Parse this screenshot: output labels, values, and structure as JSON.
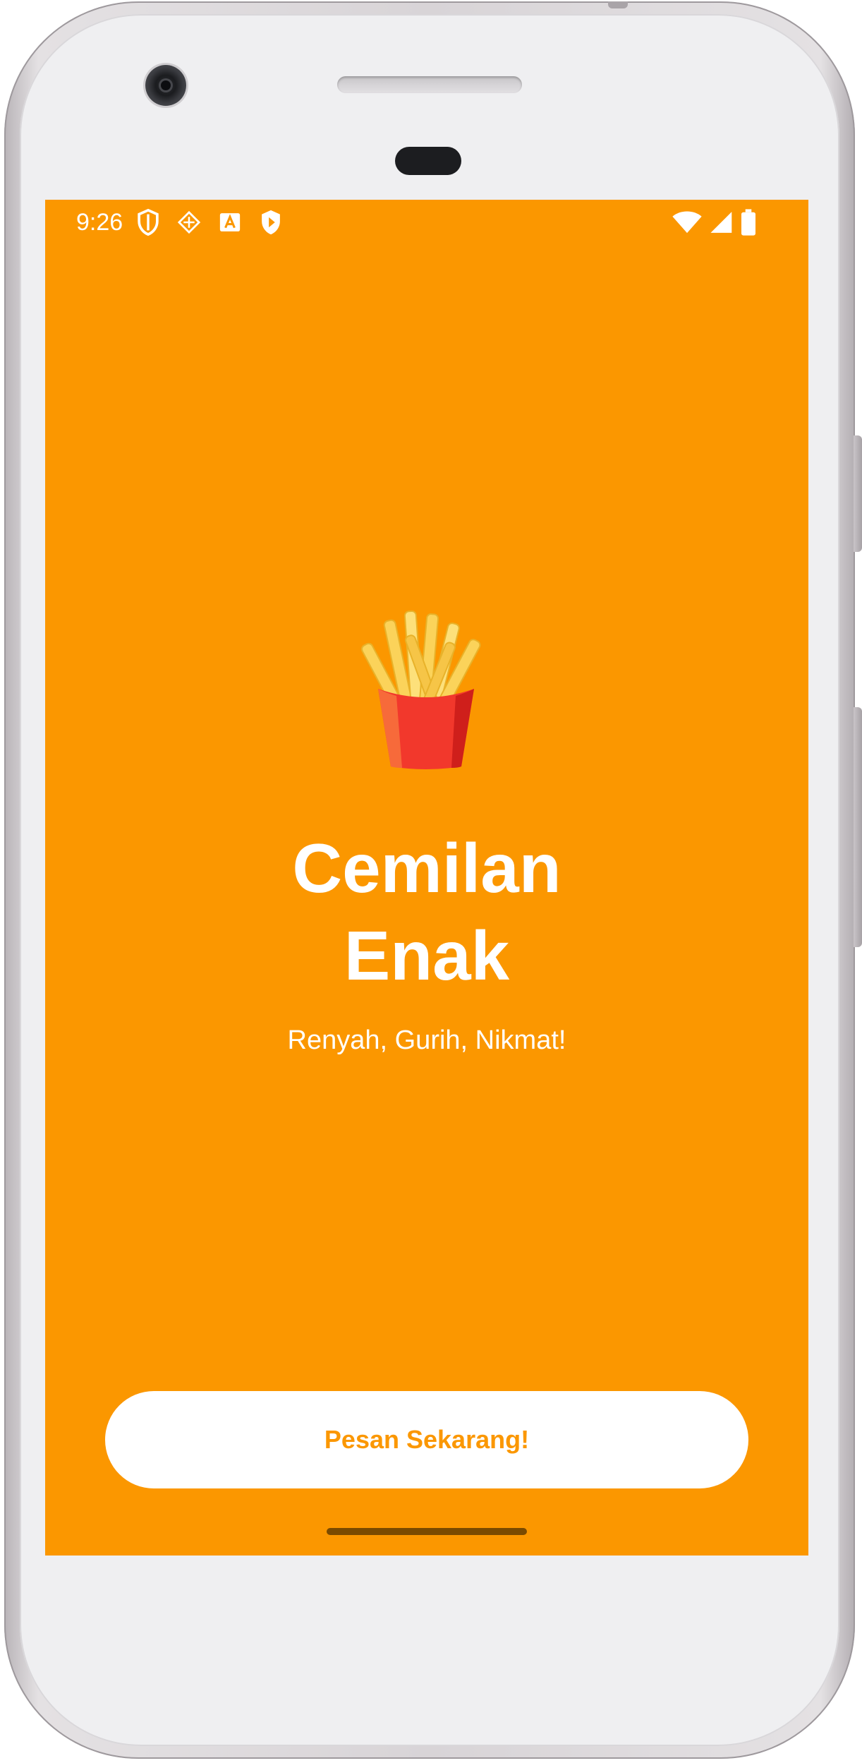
{
  "status_bar": {
    "time": "9:26",
    "left_icons": [
      "shield-outline-icon",
      "data-saver-icon",
      "font-a-icon",
      "play-shield-icon"
    ],
    "right_icons": [
      "wifi-icon",
      "cellular-signal-icon",
      "battery-icon"
    ]
  },
  "hero": {
    "icon": "french-fries-icon",
    "title_line1": "Cemilan",
    "title_line2": "Enak",
    "subtitle": "Renyah, Gurih, Nikmat!"
  },
  "cta": {
    "label": "Pesan Sekarang!"
  },
  "colors": {
    "background": "#fb9700",
    "button_bg": "#ffffff",
    "button_text": "#fb9700",
    "text": "#ffffff"
  }
}
